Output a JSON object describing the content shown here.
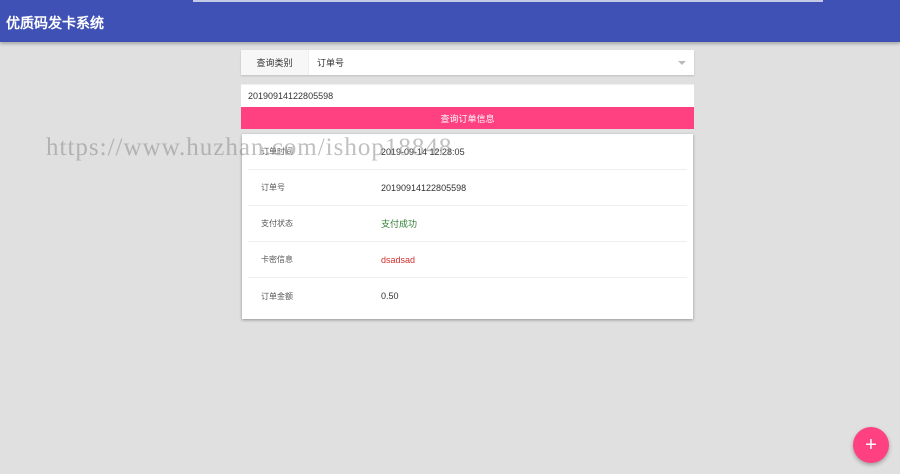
{
  "header": {
    "title": "优质码发卡系统"
  },
  "query": {
    "type_label": "查询类别",
    "type_value": "订单号",
    "order_input": "20190914122805598",
    "submit_label": "查询订单信息"
  },
  "result": {
    "rows": [
      {
        "key": "订单时间",
        "value": "2019-09-14 12:28:05"
      },
      {
        "key": "订单号",
        "value": "20190914122805598"
      },
      {
        "key": "支付状态",
        "value": "支付成功"
      },
      {
        "key": "卡密信息",
        "value": "dsadsad"
      },
      {
        "key": "订单金额",
        "value": "0.50"
      }
    ]
  },
  "watermark": "https://www.huzhan.com/ishop18848",
  "fab": {
    "label": "+"
  },
  "colors": {
    "primary": "#3f51b5",
    "accent": "#ff4081",
    "success": "#2e7d32",
    "danger": "#d32f2f"
  }
}
